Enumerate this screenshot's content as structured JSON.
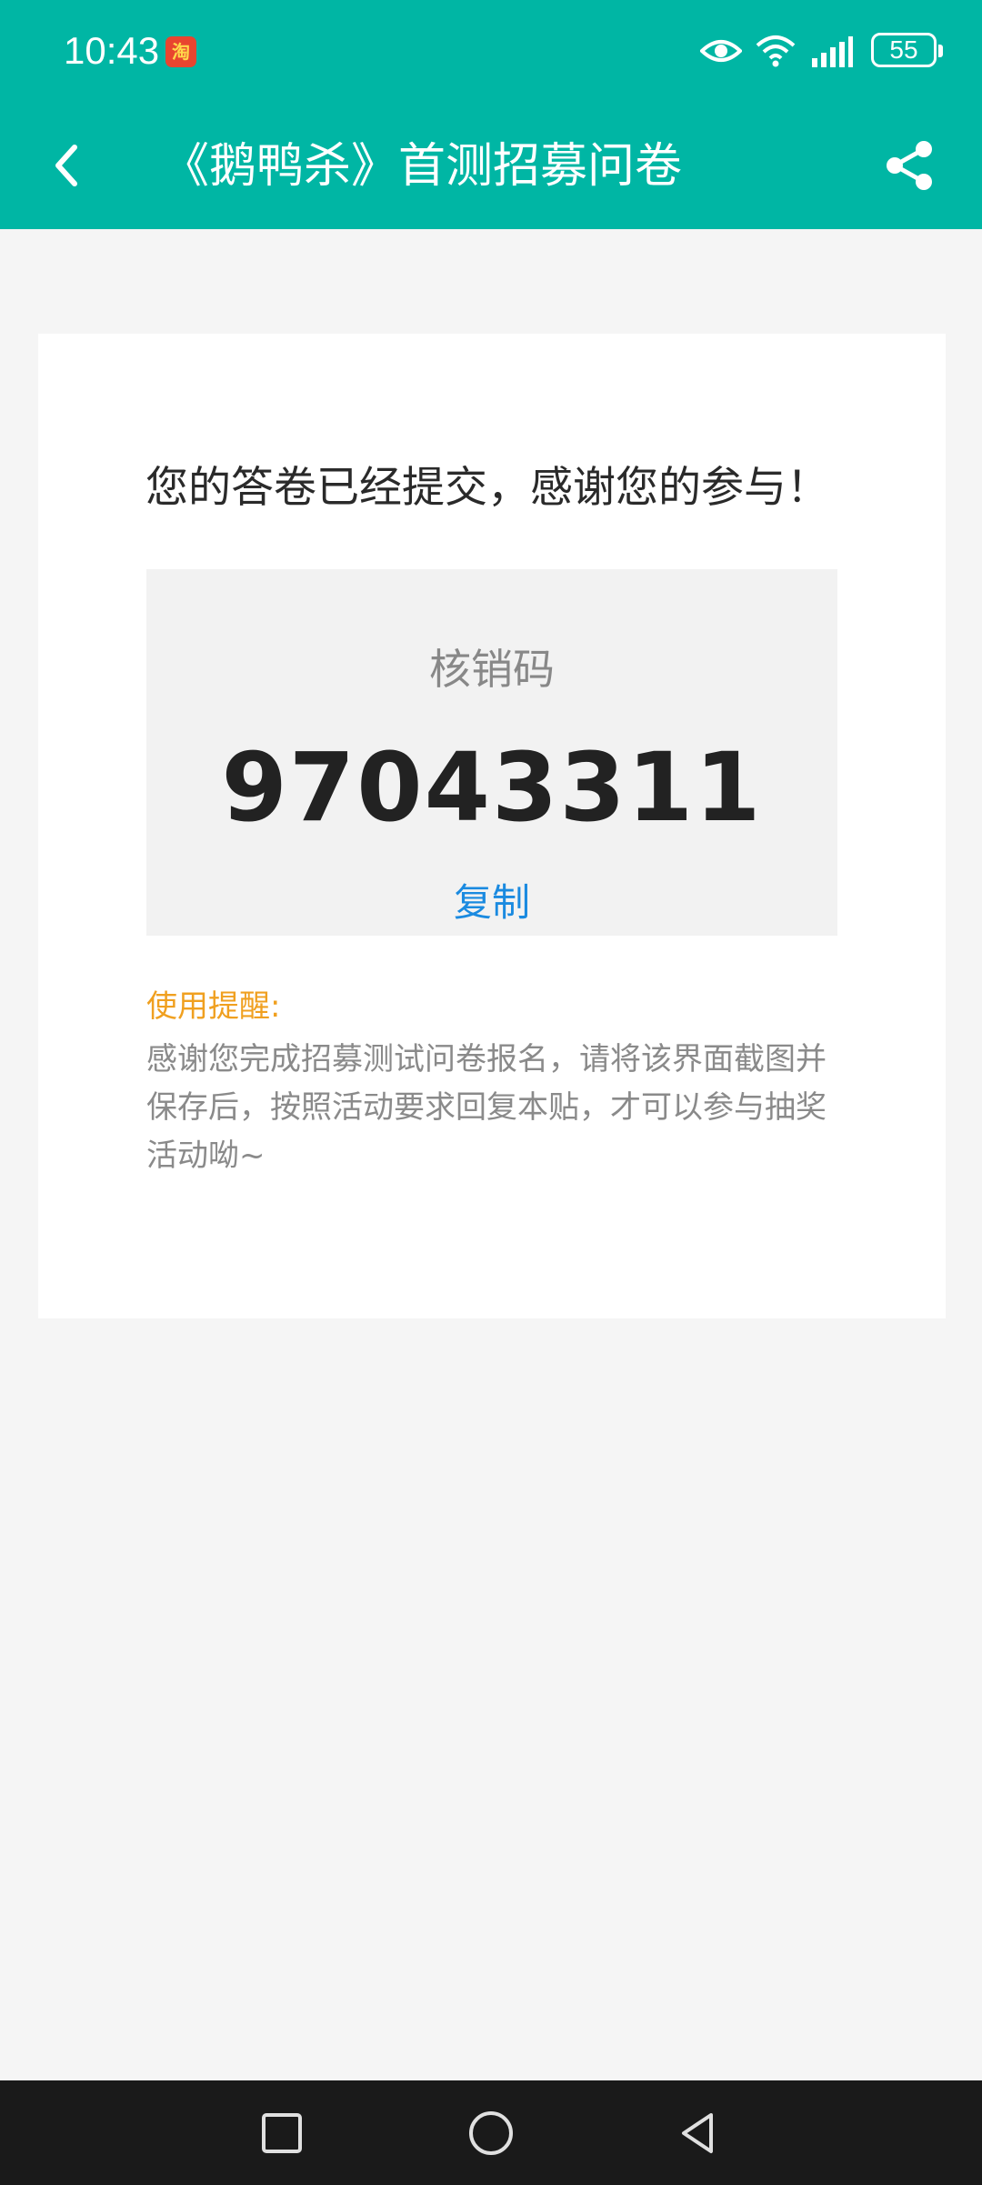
{
  "status_bar": {
    "time": "10:43",
    "app_icon_glyph": "淘",
    "battery": "55",
    "icons": [
      "eye-icon",
      "wifi-icon",
      "signal-icon",
      "battery-icon"
    ]
  },
  "app_bar": {
    "title": "《鹅鸭杀》首测招募问卷",
    "back_icon": "chevron-left-icon",
    "share_icon": "share-icon"
  },
  "result": {
    "message": "您的答卷已经提交，感谢您的参与！",
    "code_label": "核销码",
    "code_value": "97043311",
    "copy_label": "复制"
  },
  "reminder": {
    "title": "使用提醒:",
    "text": "感谢您完成招募测试问卷报名，请将该界面截图并保存后，按照活动要求回复本贴，才可以参与抽奖活动呦~"
  },
  "nav_bar": {
    "icons": [
      "recent-apps-icon",
      "home-icon",
      "back-icon"
    ]
  },
  "colors": {
    "brand": "#00b6a4",
    "link": "#1a8ae0",
    "reminder": "#f0a020"
  }
}
